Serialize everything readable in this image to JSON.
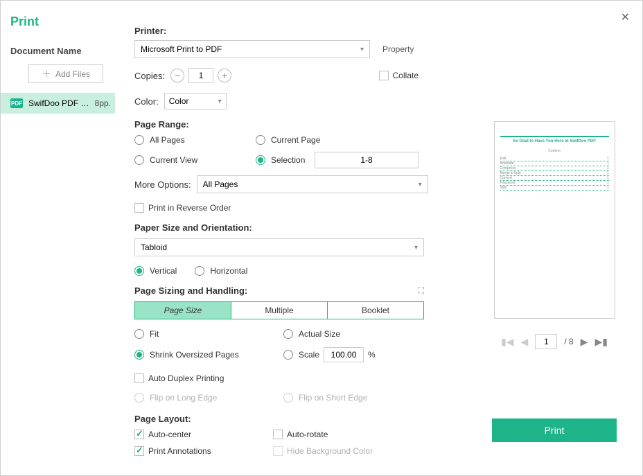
{
  "title": "Print",
  "sidebar": {
    "doc_head": "Document Name",
    "add_files": "Add Files",
    "file_name": "SwifDoo PDF Us..",
    "file_pages": "8pp."
  },
  "printer": {
    "label": "Printer:",
    "value": "Microsoft Print to PDF",
    "property": "Property"
  },
  "copies": {
    "label": "Copies:",
    "value": "1",
    "collate": "Collate"
  },
  "color": {
    "label": "Color:",
    "value": "Color"
  },
  "range": {
    "label": "Page Range:",
    "all": "All Pages",
    "current_page": "Current Page",
    "current_view": "Current View",
    "selection": "Selection",
    "selection_value": "1-8",
    "more_label": "More Options:",
    "more_value": "All Pages",
    "reverse": "Print in Reverse Order"
  },
  "paper": {
    "label": "Paper Size and Orientation:",
    "size": "Tabloid",
    "vertical": "Vertical",
    "horizontal": "Horizontal"
  },
  "sizing": {
    "label": "Page Sizing and Handling:",
    "tabs": {
      "page_size": "Page Size",
      "multiple": "Multiple",
      "booklet": "Booklet"
    },
    "fit": "Fit",
    "actual": "Actual Size",
    "shrink": "Shrink Oversized Pages",
    "scale": "Scale",
    "scale_value": "100.00",
    "scale_unit": "%"
  },
  "duplex": {
    "auto": "Auto Duplex Printing",
    "long": "Flip on Long Edge",
    "short": "Flip on Short Edge"
  },
  "layout": {
    "label": "Page Layout:",
    "auto_center": "Auto-center",
    "auto_rotate": "Auto-rotate",
    "print_anno": "Print Annotations",
    "hide_bg": "Hide Background Color"
  },
  "preview": {
    "title": "So Glad to Have You Here at SwifDoo PDF",
    "sub": "Content",
    "lines": [
      "Edit",
      "Annotate",
      "Compress",
      "Merge & Split",
      "Convert",
      "Password",
      "Sign"
    ]
  },
  "pager": {
    "current": "1",
    "total": "/ 8"
  },
  "print_btn": "Print"
}
